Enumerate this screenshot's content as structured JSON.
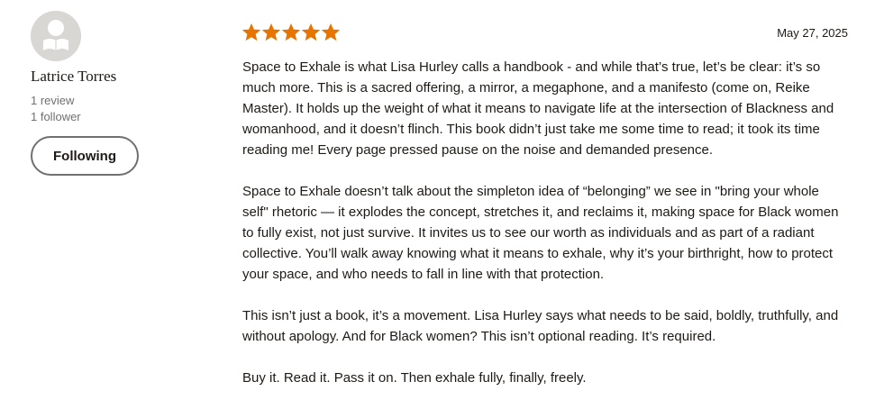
{
  "reviewer": {
    "name": "Latrice Torres",
    "reviews": "1 review",
    "followers": "1 follower",
    "follow_button": "Following",
    "avatar_icon": "reader-avatar-icon"
  },
  "review": {
    "rating": 5,
    "rating_max": 5,
    "star_color": "#e87400",
    "date": "May 27, 2025",
    "paragraphs": [
      "Space to Exhale is what Lisa Hurley calls a handbook - and while that’s true, let’s be clear: it’s so much more. This is a sacred offering, a mirror, a megaphone, and a manifesto (come on, Reike Master). It holds up the weight of what it means to navigate life at the intersection of Blackness and womanhood, and it doesn’t flinch. This book didn’t just take me some time to read; it took its time reading me! Every page pressed pause on the noise and demanded presence.",
      "Space to Exhale doesn’t talk about the simpleton idea of “belonging” we see in \"bring your whole self\" rhetoric — it explodes the concept, stretches it, and reclaims it, making space for Black women to fully exist, not just survive. It invites us to see our worth as individuals and as part of a radiant collective. You’ll walk away knowing what it means to exhale, why it’s your birthright, how to protect your space, and who needs to fall in line with that protection.",
      "This isn’t just a book, it’s a movement. Lisa Hurley says what needs to be said, boldly, truthfully, and without apology. And for Black women? This isn’t optional reading. It’s required.",
      "Buy it. Read it. Pass it on. Then exhale fully, finally, freely."
    ]
  }
}
